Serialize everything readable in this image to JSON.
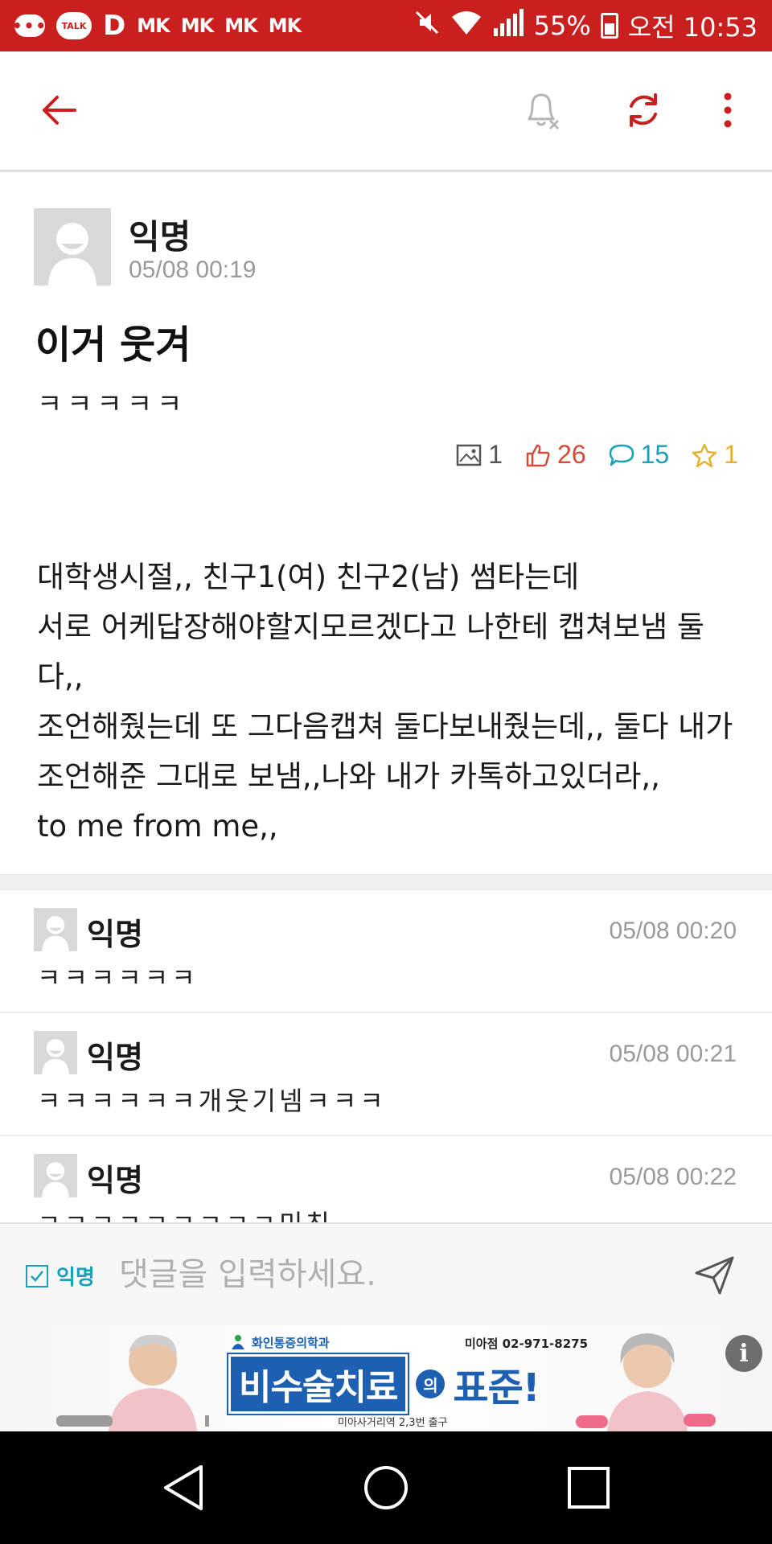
{
  "status_bar": {
    "talk_label": "TALK",
    "d_label": "D",
    "mk_labels": [
      "MK",
      "MK",
      "MK",
      "MK"
    ],
    "battery": "55%",
    "time": "오전 10:53"
  },
  "post": {
    "author": "익명",
    "date": "05/08 00:19",
    "title": "이거 웃겨",
    "body": "ㅋㅋㅋㅋㅋ",
    "stats": {
      "images": "1",
      "likes": "26",
      "comments": "15",
      "scraps": "1"
    },
    "story_lines": [
      "대학생시절,, 친구1(여) 친구2(남) 썸타는데",
      "서로 어케답장해야할지모르겠다고 나한테 캡쳐보냄 둘다,,",
      "조언해줬는데 또 그다음캡쳐 둘다보내줬는데,, 둘다 내가 조언해준 그대로 보냄,,나와 내가 카톡하고있더라,,",
      "to me from me,,"
    ]
  },
  "comments": [
    {
      "author": "익명",
      "date": "05/08 00:20",
      "text": "ㅋㅋㅋㅋㅋㅋ"
    },
    {
      "author": "익명",
      "date": "05/08 00:21",
      "text": "ㅋㅋㅋㅋㅋㅋ개웃기넴ㅋㅋㅋ"
    },
    {
      "author": "익명",
      "date": "05/08 00:22",
      "text": "ㅋㅋㅋㅋㅋㅋㅋㅋㅋ미친"
    }
  ],
  "comment_input": {
    "anonymous_label": "익명",
    "placeholder": "댓글을 입력하세요."
  },
  "ad": {
    "clinic": "화인통증의학과",
    "branch_phone": "미아점 02-971-8275",
    "headline_box": "비수술치료",
    "headline_particle": "의",
    "headline_tail": "표준!",
    "subtext": "미아사거리역 2,3번 출구"
  },
  "colors": {
    "brand_red": "#c9201f",
    "accent_teal": "#1aa0b8",
    "like_red": "#d64a3a",
    "star_yellow": "#e3b32a"
  }
}
